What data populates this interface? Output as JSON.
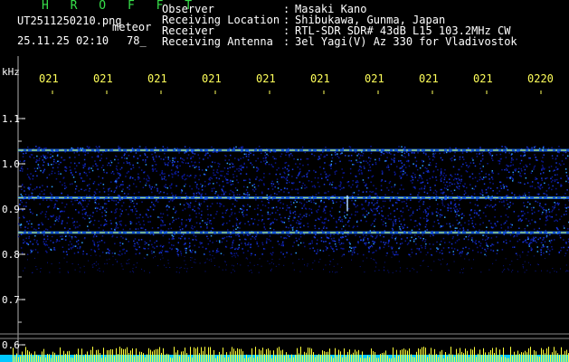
{
  "header": {
    "title": "H R O F F T",
    "file": "UT2511250210.png",
    "tag": "meteor",
    "date": "25.11.25 02:10",
    "count": "78_",
    "labels": [
      "Observer",
      "Receiving Location",
      "Receiver",
      "Receiving Antenna"
    ],
    "separator": ":",
    "values": [
      "Masaki Kano",
      "Shibukawa, Gunma, Japan",
      "RTL-SDR SDR# 43dB L15 103.2MHz CW",
      "3el Yagi(V) Az 330 for Vladivostok"
    ]
  },
  "colors": {
    "text": "#ffffff",
    "title": "#37e04a",
    "tick": "#ffff5a",
    "signal": "#c8ff60",
    "noise": "#1020d0"
  },
  "chart_data": {
    "type": "heatmap",
    "y_unit": "kHz",
    "x_tick_labels": [
      "021",
      "021",
      "021",
      "021",
      "021",
      "021",
      "021",
      "021",
      "021",
      "0220"
    ],
    "y_ticks": [
      "1.1",
      "1.0",
      "0.9",
      "0.8",
      "0.7",
      "0.6"
    ],
    "ylim": [
      0.6,
      1.1
    ],
    "signal_lines": [
      {
        "freq_khz": 1.03,
        "intensity": 0.9
      },
      {
        "freq_khz": 0.925,
        "intensity": 0.75
      },
      {
        "freq_khz": 0.848,
        "intensity": 0.85
      }
    ],
    "noise_band_khz": [
      0.8,
      1.04
    ],
    "bottom_level_bar": true
  }
}
